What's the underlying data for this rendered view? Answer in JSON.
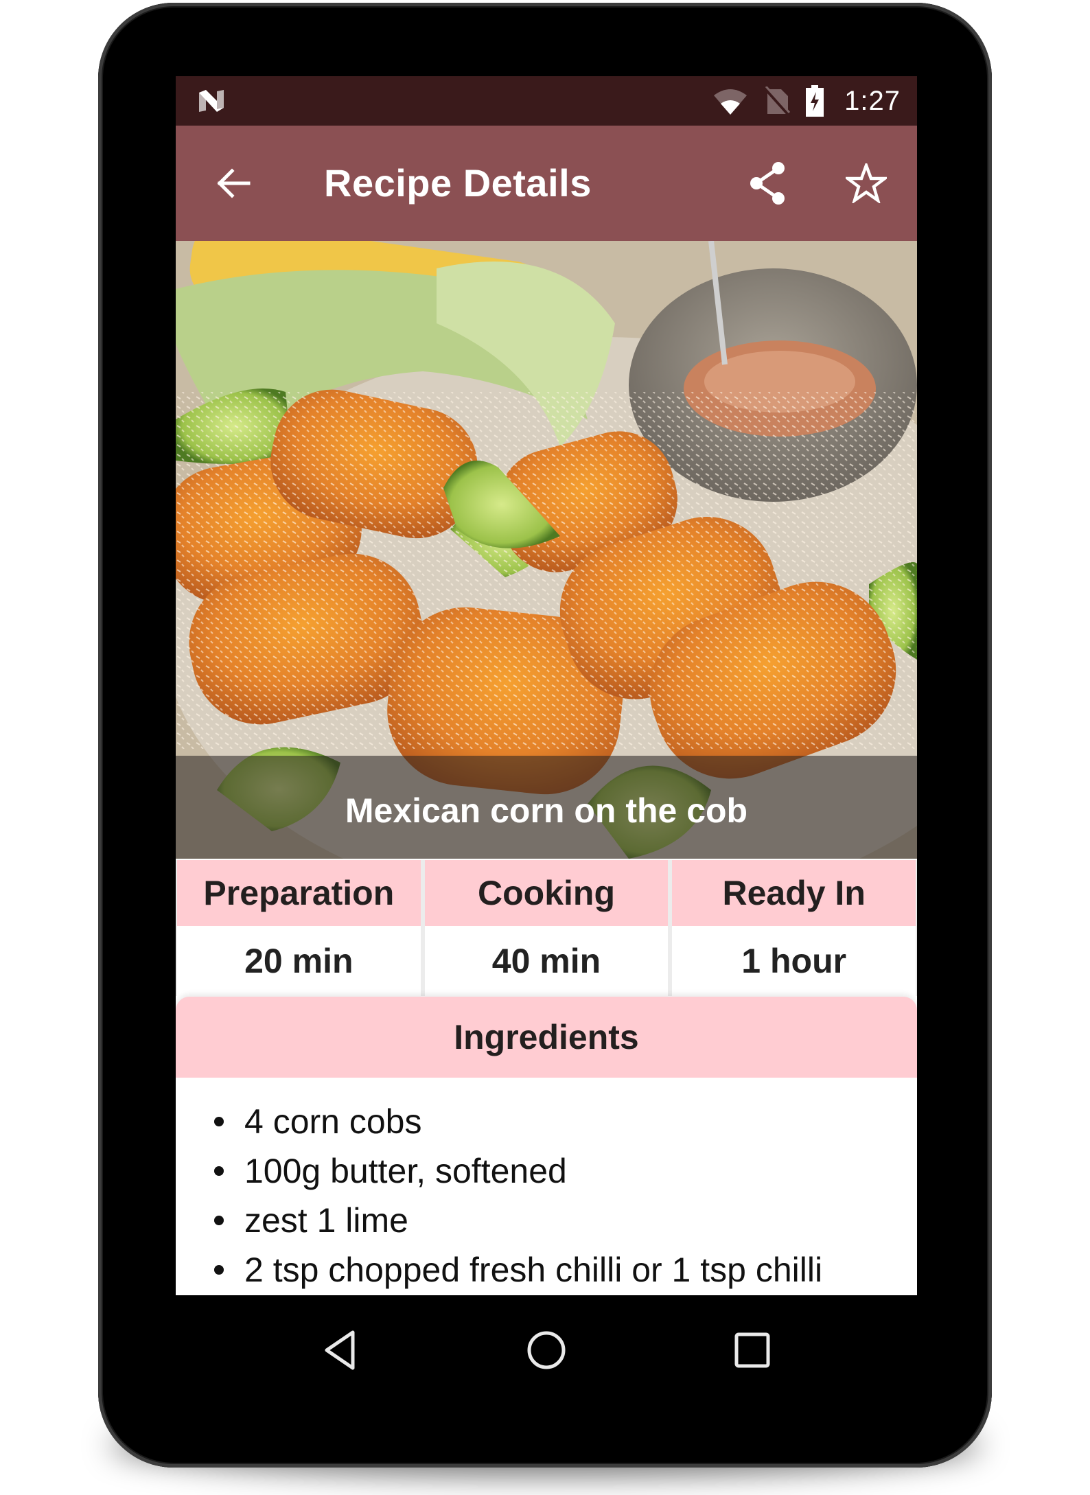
{
  "status_bar": {
    "time": "1:27",
    "icons": [
      "android-n-logo-icon",
      "wifi-icon",
      "no-sim-icon",
      "battery-charging-icon"
    ]
  },
  "toolbar": {
    "title": "Recipe Details",
    "back_icon": "arrow-left-icon",
    "share_icon": "share-icon",
    "favorite_icon": "star-outline-icon",
    "color": "#8b5053",
    "status_color": "#3a1a1b"
  },
  "recipe": {
    "name": "Mexican corn on the cob",
    "photo_alt": "Grilled corn cobs with grated cheese, chilli powder, lime wedges and a bowl of chipotle mayo"
  },
  "times": [
    {
      "label": "Preparation",
      "value": "20 min"
    },
    {
      "label": "Cooking",
      "value": "40 min"
    },
    {
      "label": "Ready In",
      "value": "1 hour"
    }
  ],
  "ingredients": {
    "title": "Ingredients",
    "items": [
      "4 corn cobs",
      "100g butter, softened",
      "zest 1 lime",
      "2 tsp chopped fresh chilli or 1 tsp chilli"
    ]
  },
  "nav_bar": {
    "back_icon": "nav-back-triangle-icon",
    "home_icon": "nav-home-circle-icon",
    "recents_icon": "nav-recents-square-icon"
  },
  "theme": {
    "accent_pink": "#ffccd2",
    "text_dark": "#231f1f"
  }
}
